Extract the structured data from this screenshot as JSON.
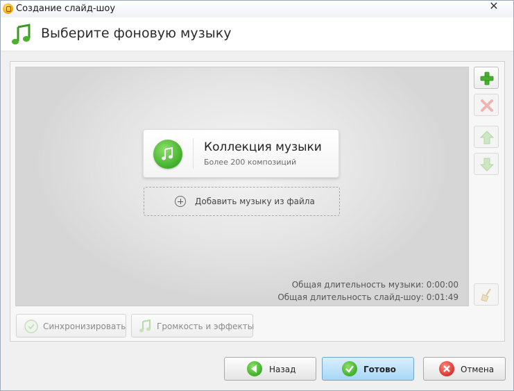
{
  "window": {
    "title": "Создание слайд-шоу",
    "close_glyph": "✕"
  },
  "header": {
    "title": "Выберите фоновую музыку",
    "icon": "music-note-icon"
  },
  "playlist": {
    "collection": {
      "title": "Коллекция музыки",
      "subtitle": "Более 200 композиций",
      "icon": "music-note-icon"
    },
    "add_file": {
      "label": "Добавить музыку из файла",
      "icon": "plus-circle-icon"
    },
    "music_duration": "Общая длительность музыки: 0:00:00",
    "slideshow_duration": "Общая длительность слайд-шоу: 0:01:49"
  },
  "side_toolbar": {
    "add_icon": "plus-icon",
    "remove_icon": "cross-icon",
    "up_icon": "arrow-up-icon",
    "down_icon": "arrow-down-icon",
    "clear_icon": "broom-icon"
  },
  "tools": {
    "sync_label": "Синхронизировать",
    "volume_label": "Громкость и эффекты"
  },
  "footer": {
    "back_label": "Назад",
    "done_label": "Готово",
    "cancel_label": "Отмена"
  },
  "colors": {
    "accent_green": "#3fae2a",
    "primary_button": "#a8d6f5",
    "cancel_red": "#d9322b"
  }
}
